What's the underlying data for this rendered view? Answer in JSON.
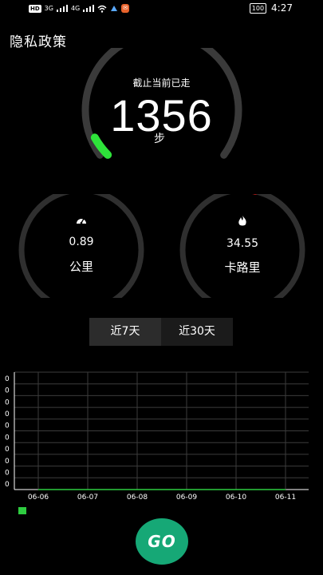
{
  "status_bar": {
    "left_badge": "HD",
    "net1": "3G",
    "net2": "4G",
    "app_badge": "✉",
    "battery": "100",
    "time": "4:27"
  },
  "header": {
    "title": "隐私政策"
  },
  "steps": {
    "caption": "截止当前已走",
    "value": "1356",
    "unit": "步",
    "progress_fraction": 0.06,
    "ring_color": "#2ee33a"
  },
  "distance": {
    "icon": "speedometer-icon",
    "value": "0.89",
    "label": "公里",
    "accent": "#19c6ea"
  },
  "calories": {
    "icon": "flame-icon",
    "value": "34.55",
    "label": "卡路里",
    "accent": "#e0201c"
  },
  "tabs": [
    {
      "label": "近7天",
      "active": true
    },
    {
      "label": "近30天",
      "active": false
    }
  ],
  "chart_data": {
    "type": "line",
    "x": [
      "06-06",
      "06-07",
      "06-08",
      "06-09",
      "06-10",
      "06-11"
    ],
    "y_tick_labels": [
      "0",
      "0",
      "0",
      "0",
      "0",
      "0",
      "0",
      "0",
      "0",
      "0"
    ],
    "series": [
      {
        "values": [
          0,
          0,
          0,
          0,
          0,
          0
        ],
        "color": "#2ecc40"
      }
    ],
    "grid": true
  },
  "go_button": {
    "label": "GO",
    "color": "#16a876"
  }
}
